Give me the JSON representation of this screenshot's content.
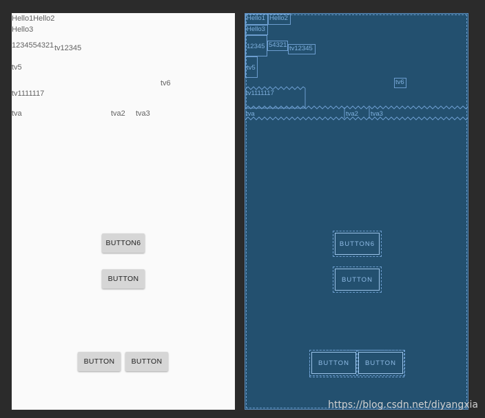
{
  "design": {
    "texts": {
      "hello1hello2": "Hello1Hello2",
      "hello3": "Hello3",
      "n12345": "1234554321",
      "tv12345": "tv12345",
      "tv5": "tv5",
      "tv6": "tv6",
      "tv1111117": "tv1111117",
      "tva": "tva",
      "tva2": "tva2",
      "tva3": "tva3"
    },
    "buttons": {
      "button6": "BUTTON6",
      "button": "BUTTON",
      "button_left": "BUTTON",
      "button_right": "BUTTON"
    }
  },
  "blueprint": {
    "hello1": "Hello1",
    "hello2": "Hello2",
    "hello3": "Hello3",
    "n12345": "12345",
    "n54321": "54321",
    "tv12345": "tv12345",
    "tv5": "tv5",
    "tv6": "tv6",
    "tv1111117": "tv1111117",
    "tva": "tva",
    "tva2": "tva2",
    "tva3": "tva3",
    "button6": "BUTTON6",
    "button": "BUTTON",
    "button_left": "BUTTON",
    "button_right": "BUTTON"
  },
  "watermark": "https://blog.csdn.net/diyangxia"
}
